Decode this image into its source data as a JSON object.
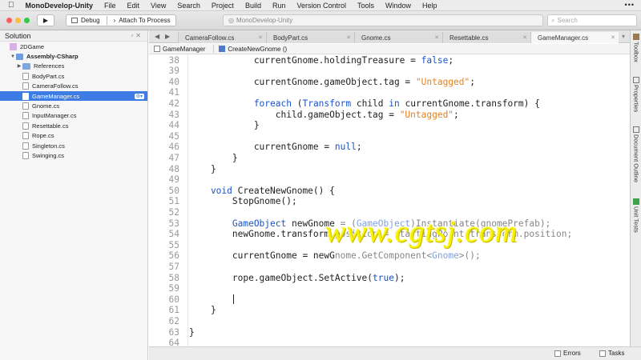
{
  "menubar": {
    "app_name": "MonoDevelop-Unity",
    "items": [
      "File",
      "Edit",
      "View",
      "Search",
      "Project",
      "Build",
      "Run",
      "Version Control",
      "Tools",
      "Window",
      "Help"
    ]
  },
  "toolbar": {
    "configuration": "Debug",
    "target": "Attach To Process",
    "window_title": "MonoDevelop-Unity",
    "search_placeholder": "Search"
  },
  "solution": {
    "title": "Solution",
    "tree": [
      {
        "label": "2DGame",
        "kind": "solution",
        "depth": 0,
        "arrow": ""
      },
      {
        "label": "Assembly-CSharp",
        "kind": "project",
        "depth": 1,
        "arrow": "▼"
      },
      {
        "label": "References",
        "kind": "folder",
        "depth": 2,
        "arrow": "▶"
      },
      {
        "label": "BodyPart.cs",
        "kind": "file",
        "depth": 2,
        "arrow": ""
      },
      {
        "label": "CameraFollow.cs",
        "kind": "file",
        "depth": 2,
        "arrow": ""
      },
      {
        "label": "GameManager.cs",
        "kind": "file",
        "depth": 2,
        "arrow": "",
        "selected": true
      },
      {
        "label": "Gnome.cs",
        "kind": "file",
        "depth": 2,
        "arrow": ""
      },
      {
        "label": "InputManager.cs",
        "kind": "file",
        "depth": 2,
        "arrow": ""
      },
      {
        "label": "Resettable.cs",
        "kind": "file",
        "depth": 2,
        "arrow": ""
      },
      {
        "label": "Rope.cs",
        "kind": "file",
        "depth": 2,
        "arrow": ""
      },
      {
        "label": "Singleton.cs",
        "kind": "file",
        "depth": 2,
        "arrow": ""
      },
      {
        "label": "Swinging.cs",
        "kind": "file",
        "depth": 2,
        "arrow": ""
      }
    ]
  },
  "tabs": [
    {
      "label": "CameraFollow.cs"
    },
    {
      "label": "BodyPart.cs"
    },
    {
      "label": "Gnome.cs"
    },
    {
      "label": "Resettable.cs"
    },
    {
      "label": "GameManager.cs",
      "active": true
    }
  ],
  "breadcrumb": {
    "class_name": "GameManager",
    "method_name": "CreateNewGnome ()"
  },
  "editor": {
    "lines": [
      {
        "n": "38",
        "tokens": [
          [
            "",
            "            currentGnome.holdingTreasure = "
          ],
          [
            "kw",
            "false"
          ],
          [
            "",
            ";"
          ]
        ]
      },
      {
        "n": "39",
        "tokens": []
      },
      {
        "n": "40",
        "tokens": [
          [
            "",
            "            currentGnome.gameObject.tag = "
          ],
          [
            "str",
            "\"Untagged\""
          ],
          [
            "",
            ";"
          ]
        ]
      },
      {
        "n": "41",
        "tokens": []
      },
      {
        "n": "42",
        "tokens": [
          [
            "kw",
            "            foreach"
          ],
          [
            "",
            " ("
          ],
          [
            "ty",
            "Transform"
          ],
          [
            "",
            " child "
          ],
          [
            "kw",
            "in"
          ],
          [
            "",
            " currentGnome.transform) {"
          ]
        ]
      },
      {
        "n": "43",
        "tokens": [
          [
            "",
            "                child.gameObject.tag = "
          ],
          [
            "str",
            "\"Untagged\""
          ],
          [
            "",
            ";"
          ]
        ]
      },
      {
        "n": "44",
        "tokens": [
          [
            "",
            "            }"
          ]
        ]
      },
      {
        "n": "45",
        "tokens": []
      },
      {
        "n": "46",
        "tokens": [
          [
            "",
            "            currentGnome = "
          ],
          [
            "kw",
            "null"
          ],
          [
            "",
            ";"
          ]
        ]
      },
      {
        "n": "47",
        "tokens": [
          [
            "",
            "        }"
          ]
        ]
      },
      {
        "n": "48",
        "tokens": [
          [
            "",
            "    }"
          ]
        ]
      },
      {
        "n": "49",
        "tokens": []
      },
      {
        "n": "50",
        "tokens": [
          [
            "kw",
            "    void"
          ],
          [
            "",
            " CreateNewGnome() {"
          ]
        ]
      },
      {
        "n": "51",
        "tokens": [
          [
            "",
            "        StopGnome();"
          ]
        ]
      },
      {
        "n": "52",
        "tokens": []
      },
      {
        "n": "53",
        "tokens": [
          [
            "ty",
            "        GameObject"
          ],
          [
            "",
            " newGnome = ("
          ],
          [
            "ty",
            "GameObject"
          ],
          [
            "",
            ")Instantiate(gnomePrefab);"
          ]
        ]
      },
      {
        "n": "54",
        "tokens": [
          [
            "",
            "        newGnome.transform.position = startingPoint.transform.position;"
          ]
        ]
      },
      {
        "n": "55",
        "tokens": []
      },
      {
        "n": "56",
        "tokens": [
          [
            "",
            "        currentGnome = newGnome.GetComponent<"
          ],
          [
            "ty",
            "Gnome"
          ],
          [
            "",
            ">();"
          ]
        ]
      },
      {
        "n": "57",
        "tokens": []
      },
      {
        "n": "58",
        "tokens": [
          [
            "",
            "        rope.gameObject.SetActive("
          ],
          [
            "kw",
            "true"
          ],
          [
            "",
            ");"
          ]
        ]
      },
      {
        "n": "59",
        "tokens": []
      },
      {
        "n": "60",
        "tokens": [],
        "caret": true
      },
      {
        "n": "61",
        "tokens": [
          [
            "",
            "    }"
          ]
        ]
      },
      {
        "n": "62",
        "tokens": []
      },
      {
        "n": "63",
        "tokens": [
          [
            "",
            "}"
          ]
        ]
      },
      {
        "n": "64",
        "tokens": []
      }
    ]
  },
  "watermark": "www.cgtsj.com",
  "rightdock": {
    "toolbox": "Toolbox",
    "properties": "Properties",
    "document_outline": "Document Outline",
    "unit_tests": "Unit Tests"
  },
  "statusbar": {
    "errors": "Errors",
    "tasks": "Tasks"
  },
  "colors": {
    "keyword": "#1a53c6",
    "string": "#e8801a",
    "selection": "#3d7ce5"
  }
}
